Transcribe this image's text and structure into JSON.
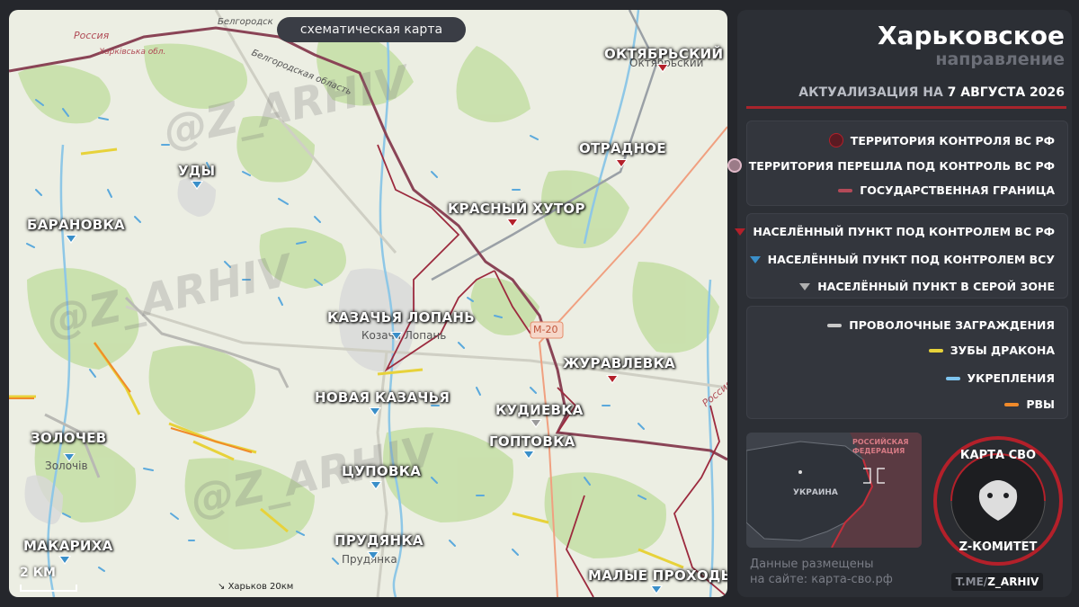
{
  "map": {
    "chip": "схематическая карта",
    "scale": "2 КМ",
    "harkiv_ref": "Харьков 20км",
    "watermark": "@Z_ARHIV",
    "places": [
      {
        "name": "ОКТЯБРЬСКИЙ",
        "status": "ru"
      },
      {
        "name": "ОТРАДНОЕ",
        "status": "ru"
      },
      {
        "name": "УДЫ",
        "status": "ua"
      },
      {
        "name": "КРАСНЫЙ ХУТОР",
        "status": "ru"
      },
      {
        "name": "БАРАНОВКА",
        "status": "ua"
      },
      {
        "name": "КАЗАЧЬЯ ЛОПАНЬ",
        "status": "ua"
      },
      {
        "name": "ЖУРАВЛЕВКА",
        "status": "ru"
      },
      {
        "name": "НОВАЯ КАЗАЧЬЯ",
        "status": "ua"
      },
      {
        "name": "КУДИЕВКА",
        "status": "gray"
      },
      {
        "name": "ГОПТОВКА",
        "status": "ua"
      },
      {
        "name": "ЗОЛОЧЕВ",
        "status": "ua"
      },
      {
        "name": "ЦУПОВКА",
        "status": "ua"
      },
      {
        "name": "ПРУДЯНКА",
        "status": "ua"
      },
      {
        "name": "МАКАРИХА",
        "status": "ua"
      },
      {
        "name": "МАЛЫЕ ПРОХОДЫ",
        "status": "ua"
      }
    ],
    "base_labels": {
      "russia_top": "Россия",
      "kharkiv_obl": "Харківська обл.",
      "belgorod_obl": "Белгородская область",
      "belgorod_top": "Белгородск",
      "kazachya_lopan": "Козача Лопань",
      "zolochiv": "Золочів",
      "prudyanka": "Прудянка",
      "oktyabr": "Октябрьский",
      "russia_right": "Россия",
      "m20": "М-20"
    }
  },
  "panel": {
    "title": "Харьковское",
    "subtitle": "направление",
    "date_prefix": "АКТУАЛИЗАЦИЯ НА ",
    "date_value": "7 АВГУСТА 2026",
    "legend_territory": [
      "ТЕРРИТОРИЯ КОНТРОЛЯ ВС РФ",
      "ТЕРРИТОРИЯ ПЕРЕШЛА ПОД КОНТРОЛЬ ВС РФ",
      "ГОСУДАРСТВЕННАЯ ГРАНИЦА"
    ],
    "legend_settlements": [
      "НАСЕЛЁННЫЙ ПУНКТ ПОД КОНТРОЛЕМ ВС РФ",
      "НАСЕЛЁННЫЙ ПУНКТ ПОД КОНТРОЛЕМ ВСУ",
      "НАСЕЛЁННЫЙ ПУНКТ В СЕРОЙ ЗОНЕ"
    ],
    "legend_fortifications": [
      "ПРОВОЛОЧНЫЕ ЗАГРАЖДЕНИЯ",
      "ЗУБЫ ДРАКОНА",
      "УКРЕПЛЕНИЯ",
      "РВЫ"
    ],
    "minimap": {
      "russia": "РОССИЙСКАЯ ФЕДЕРАЦИЯ",
      "ukraine": "УКРАИНА"
    },
    "posted_line1": "Данные размещены",
    "posted_line2": "на сайте: карта-сво.рф",
    "logo_top": "КАРТА СВО",
    "logo_bottom": "Z-КОМИТЕТ",
    "tme_prefix": "T.ME/",
    "tme_handle": "Z_ARHIV"
  },
  "colors": {
    "ru_control": "#b3202a",
    "ua_control": "#3a8fc9",
    "gray_zone": "#9a9a9a",
    "border": "#7a3c4a",
    "wire": "#c9c9c9",
    "dragon_teeth": "#e7d23a",
    "fortifications": "#7ec4ee",
    "ditches": "#f08a2a"
  }
}
